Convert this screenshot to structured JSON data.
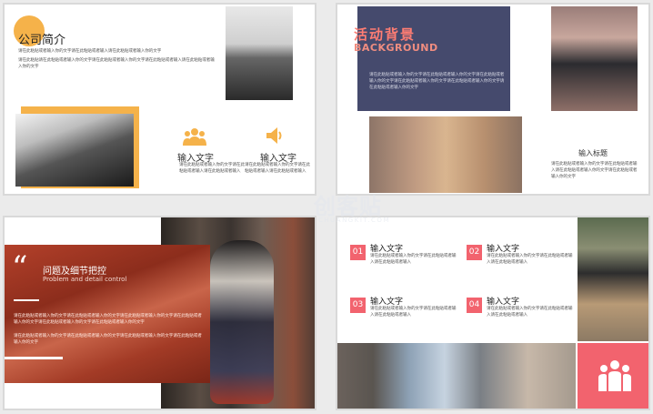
{
  "slide1": {
    "title": "公司简介",
    "para1": "请在此粘贴或者输入你的文字请在此粘贴或者输入请在此粘贴或者输入你的文字",
    "para2": "请在此粘贴请在此粘贴或者输入你的文字请在此粘贴或者输入你的文字请在此粘贴或者输入请在此粘贴或者输入你的文字",
    "items": [
      {
        "label": "输入文字",
        "desc": "请在此粘贴或者输入你的文字请在此粘贴或者输入请在此粘贴或者输入"
      },
      {
        "label": "输入文字",
        "desc": "请在此粘贴或者输入你的文字请在此粘贴或者输入请在此粘贴或者输入"
      }
    ],
    "icons": [
      "people-icon",
      "speaker-icon"
    ],
    "accent": "#f5b24a"
  },
  "slide2": {
    "title_cn": "活动背景",
    "title_en": "BACKGROUND",
    "body": "请在此粘贴或者输入你的文字请在此粘贴或者输入你的文字请在此粘贴或者输入你的文字请在此粘贴或者输入你的文字请在此粘贴或者输入你的文字请在此粘贴或者输入你的文字",
    "caption_label": "输入标题",
    "caption_desc": "请在此粘贴或者输入你的文字请在此粘贴或者输入请在此粘贴或者输入你的文字请在此粘贴或者输入你的文字",
    "accent": "#454a6d",
    "title_color": "#ff7d73"
  },
  "slide3": {
    "quote_mark": "“",
    "title_cn": "问题及细节把控",
    "title_en": "Problem and detail control",
    "para1": "请在此粘贴或者输入你的文字请在此粘贴或者输入你的文字请在此粘贴或者输入你的文字请在此粘贴或者输入你的文字请在此粘贴或者输入你的文字请在此粘贴或者输入你的文字",
    "para2": "请在此粘贴或者输入你的文字请在此粘贴或者输入你的文字请在此粘贴或者输入你的文字请在此粘贴或者输入你的文字",
    "accent": "#b3402a"
  },
  "slide4": {
    "items": [
      {
        "num": "01",
        "label": "输入文字",
        "desc": "请在此粘贴或者输入你的文字请在此粘贴或者输入请在此粘贴或者输入"
      },
      {
        "num": "02",
        "label": "输入文字",
        "desc": "请在此粘贴或者输入你的文字请在此粘贴或者输入请在此粘贴或者输入"
      },
      {
        "num": "03",
        "label": "输入文字",
        "desc": "请在此粘贴或者输入你的文字请在此粘贴或者输入请在此粘贴或者输入"
      },
      {
        "num": "04",
        "label": "输入文字",
        "desc": "请在此粘贴或者输入你的文字请在此粘贴或者输入请在此粘贴或者输入"
      }
    ],
    "icon": "group-icon",
    "accent": "#f2636e"
  },
  "watermark": {
    "text": "创客贴",
    "sub": "CHUANGKIT.COM"
  }
}
